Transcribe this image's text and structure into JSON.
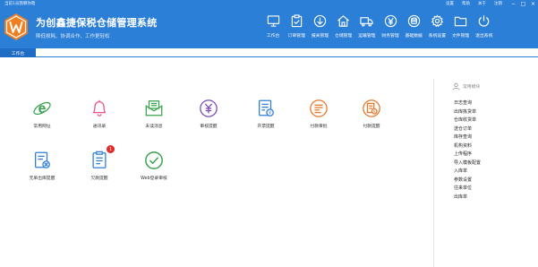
{
  "window": {
    "title": "当前1员我哪你嗯",
    "links": [
      "设置",
      "帮助",
      "关于",
      "注销"
    ],
    "controls": [
      "−",
      "□",
      "×"
    ]
  },
  "app": {
    "title": "为创鑫捷保税仓储管理系统",
    "slogan": "降低损耗、协调合作、工作更轻松"
  },
  "nav": [
    {
      "label": "工作台",
      "icon": "monitor-icon"
    },
    {
      "label": "订单管理",
      "icon": "clipboard-check-icon"
    },
    {
      "label": "报关管理",
      "icon": "download-circle-icon"
    },
    {
      "label": "仓储管理",
      "icon": "warehouse-icon"
    },
    {
      "label": "运输管理",
      "icon": "truck-icon"
    },
    {
      "label": "财务管理",
      "icon": "yen-icon"
    },
    {
      "label": "基础数据",
      "icon": "database-icon"
    },
    {
      "label": "系统设置",
      "icon": "gear-icon"
    },
    {
      "label": "文件管理",
      "icon": "folder-icon"
    },
    {
      "label": "退出系统",
      "icon": "power-icon"
    }
  ],
  "tabs": [
    {
      "label": "工作台"
    }
  ],
  "tiles": [
    {
      "label": "常用网址",
      "icon": "ie-browser-icon"
    },
    {
      "label": "通讯录",
      "icon": "bell-icon"
    },
    {
      "label": "未读消息",
      "icon": "envelope-icon"
    },
    {
      "label": "审核提醒",
      "icon": "yen-circle-icon"
    },
    {
      "label": "开票提醒",
      "icon": "invoice-icon"
    },
    {
      "label": "付款审批",
      "icon": "payment-doc-icon"
    },
    {
      "label": "付款提醒",
      "icon": "payment-reminder-icon"
    },
    {
      "label": "无单出库提醒",
      "icon": "no-order-icon"
    },
    {
      "label": "欠款提醒",
      "icon": "debt-doc-icon",
      "badge": "1"
    },
    {
      "label": "Web登录审核",
      "icon": "check-circle-icon"
    }
  ],
  "side": {
    "header": "常用模块",
    "items": [
      "日志查询",
      "出库拣货单",
      "仓库收货单",
      "送仓订单",
      "库存查询",
      "机构资料",
      "上传程序",
      "导入模板配置",
      "入库单",
      "参数设置",
      "往来单位",
      "出库单"
    ]
  },
  "colors": {
    "header": "#2c7fd6",
    "tab_active": "#1e6cc4",
    "green": "#3aa24e",
    "pink": "#e8548f",
    "purple": "#7b4bb5",
    "blue": "#2f7ed8",
    "orange": "#e8782a",
    "red_badge": "#e02b2b"
  }
}
